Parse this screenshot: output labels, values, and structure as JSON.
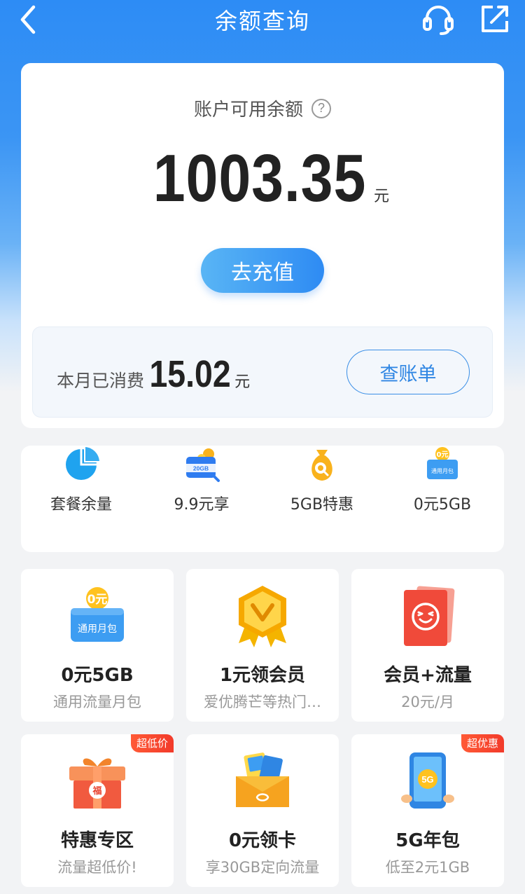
{
  "nav": {
    "title": "余额查询"
  },
  "balance": {
    "label": "账户可用余额",
    "help": "?",
    "amount": "1003.35",
    "unit": "元",
    "recharge_label": "去充值"
  },
  "month": {
    "label": "本月已消费",
    "amount": "15.02",
    "unit": "元",
    "bill_label": "查账单"
  },
  "quick": [
    {
      "label": "套餐余量",
      "icon": "pie-chart-icon"
    },
    {
      "label": "9.9元享",
      "icon": "20gb-data-icon",
      "icon_text": "20GB"
    },
    {
      "label": "5GB特惠",
      "icon": "money-bag-icon"
    },
    {
      "label": "0元5GB",
      "icon": "monthly-pack-icon",
      "icon_text": "0元",
      "icon_sub": "通用月包"
    }
  ],
  "tiles": [
    {
      "title": "0元5GB",
      "sub": "通用流量月包",
      "icon": "monthly-pack-icon",
      "icon_text": "0元",
      "icon_sub": "通用月包"
    },
    {
      "title": "1元领会员",
      "sub": "爱优腾芒等热门…",
      "icon": "vip-badge-icon"
    },
    {
      "title": "会员+流量",
      "sub": "20元/月",
      "icon": "smile-card-icon"
    },
    {
      "title": "特惠专区",
      "sub": "流量超低价!",
      "icon": "gift-box-icon",
      "badge": "超低价",
      "icon_text": "福"
    },
    {
      "title": "0元领卡",
      "sub": "享30GB定向流量",
      "icon": "sim-envelope-icon"
    },
    {
      "title": "5G年包",
      "sub": "低至2元1GB",
      "icon": "5g-phone-icon",
      "badge": "超优惠",
      "icon_text": "5G"
    }
  ],
  "colors": {
    "brand_blue": "#2e8bf3",
    "header_top": "#2d8cf5",
    "badge_red": "#f23a2a"
  }
}
